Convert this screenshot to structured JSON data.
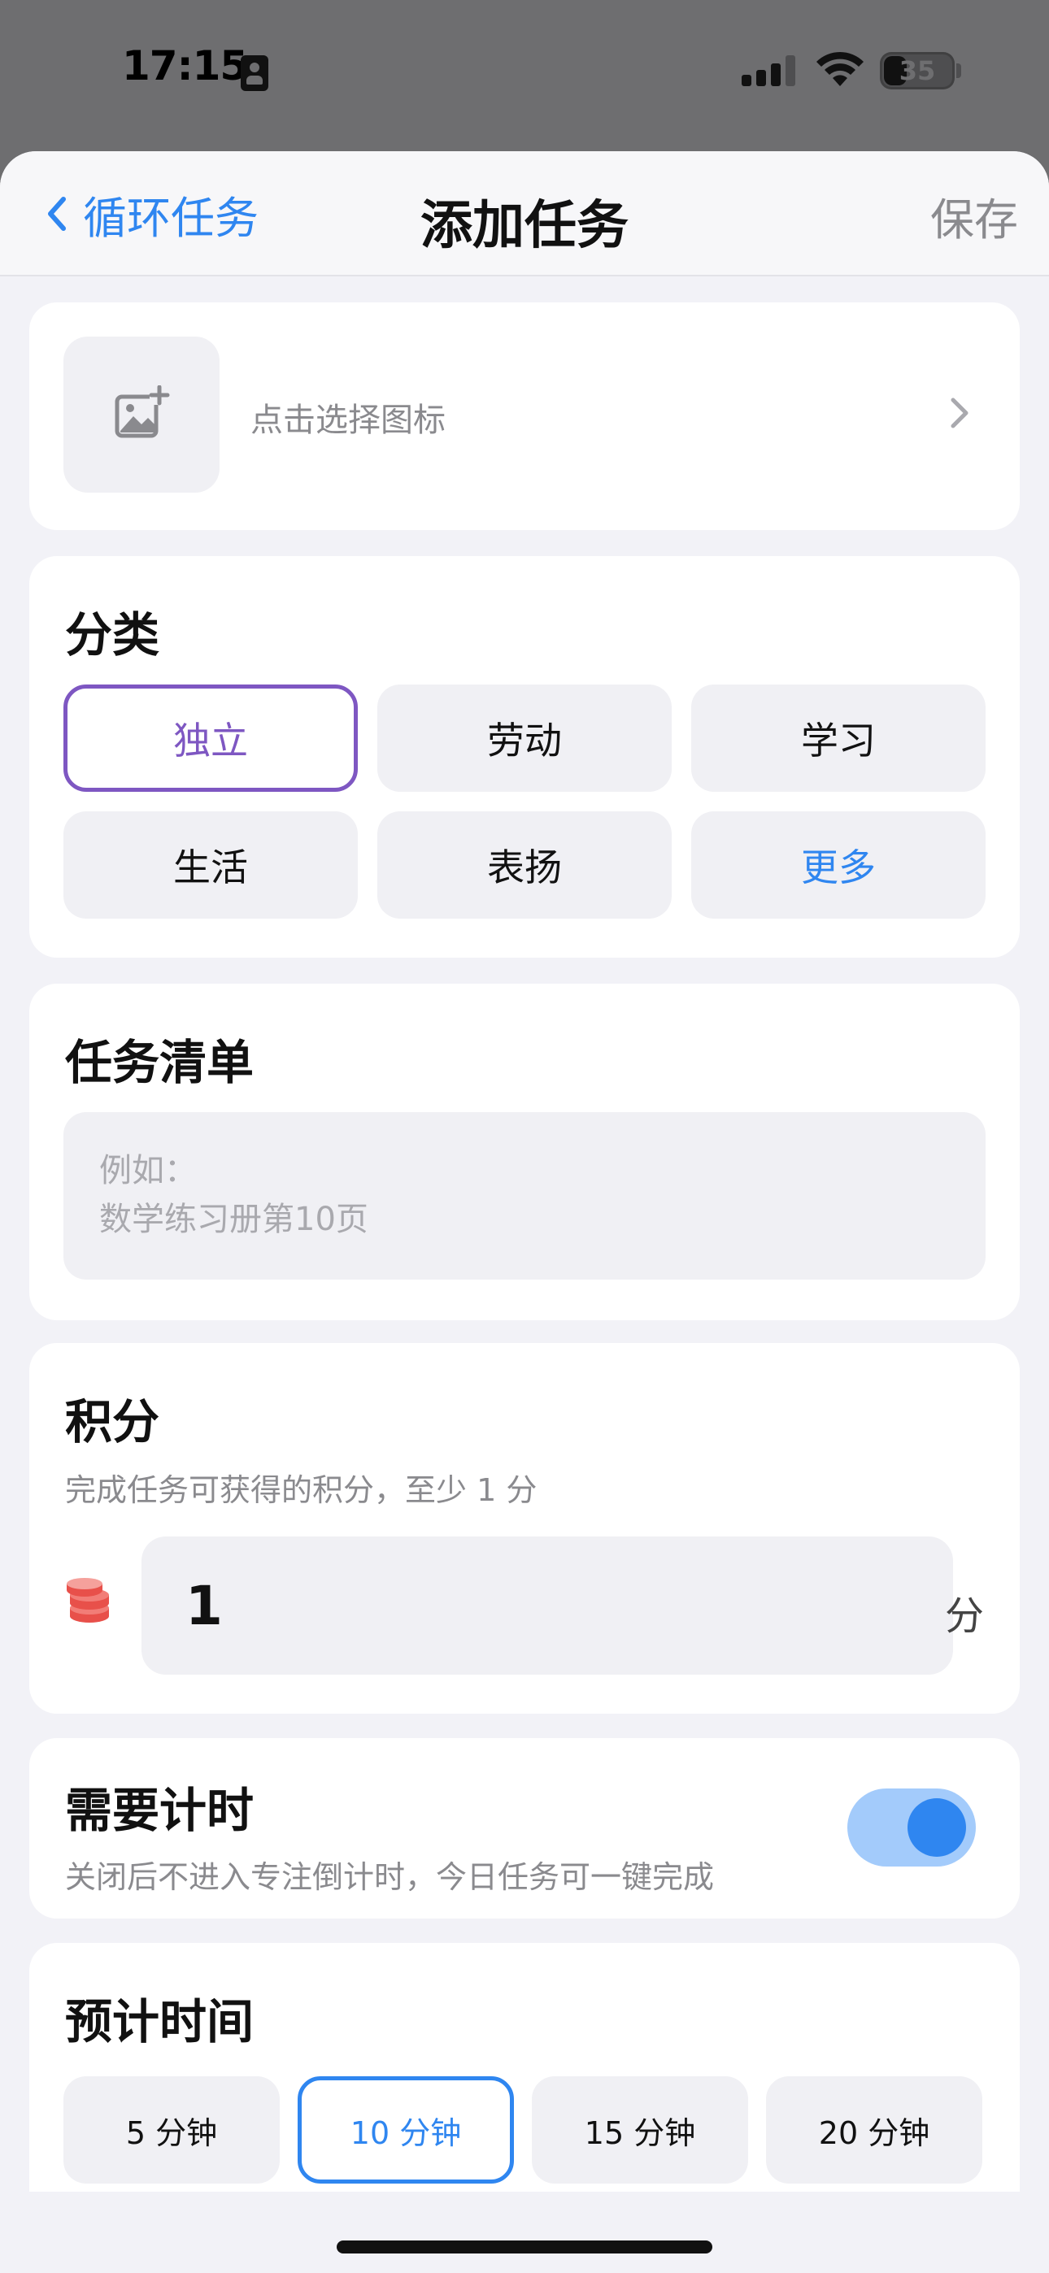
{
  "status_bar": {
    "time": "17:15",
    "battery": "35"
  },
  "nav": {
    "back_label": "循环任务",
    "title": "添加任务",
    "save_label": "保存"
  },
  "icon_picker": {
    "label": "点击选择图标"
  },
  "category": {
    "title": "分类",
    "options": [
      "独立",
      "劳动",
      "学习",
      "生活",
      "表扬",
      "更多"
    ],
    "selected": "独立"
  },
  "task_list": {
    "title": "任务清单",
    "placeholder": "例如：\n数学练习册第10页"
  },
  "points": {
    "title": "积分",
    "hint": "完成任务可获得的积分，至少 1 分",
    "value": "1",
    "unit": "分"
  },
  "timer": {
    "title": "需要计时",
    "hint": "关闭后不进入专注倒计时，今日任务可一键完成",
    "enabled": true
  },
  "estimated_time": {
    "title": "预计时间",
    "options": [
      "5 分钟",
      "10 分钟",
      "15 分钟",
      "20 分钟"
    ],
    "selected": "10 分钟"
  },
  "colors": {
    "accent_blue": "#2f86f0",
    "category_selected": "#7e57c2",
    "coin_red": "#e8504a"
  }
}
